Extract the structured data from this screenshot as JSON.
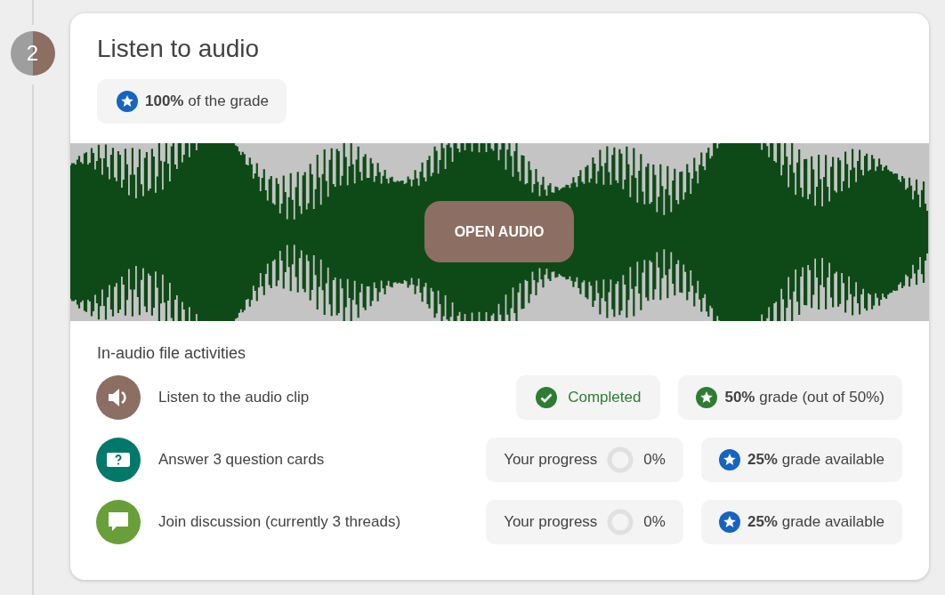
{
  "step": {
    "number": "2"
  },
  "card": {
    "title": "Listen to audio",
    "grade_badge": "**100%** of the grade",
    "media": {
      "button": "OPEN AUDIO"
    },
    "section_heading": "In-audio file activities"
  },
  "activities": [
    {
      "kind": "audio",
      "label": "Listen to the audio clip",
      "status": {
        "kind": "completed",
        "text": "Completed"
      },
      "grade": {
        "kind": "earned",
        "text": "**50%** grade (out of 50%)"
      }
    },
    {
      "kind": "question",
      "label": "Answer 3 question cards",
      "status": {
        "kind": "progress",
        "text": "Your progress",
        "level": 0,
        "reading": "0%"
      },
      "grade": {
        "kind": "available",
        "text": "**25%** grade available"
      }
    },
    {
      "kind": "discussion",
      "label": "Join discussion (currently 3 threads)",
      "status": {
        "kind": "progress",
        "text": "Your progress",
        "level": 0,
        "reading": "0%"
      },
      "grade": {
        "kind": "available",
        "text": "**25%** grade available"
      }
    }
  ]
}
